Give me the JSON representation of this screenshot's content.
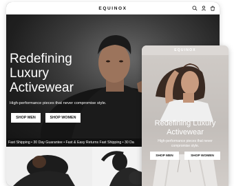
{
  "desktop": {
    "brand": "EQUINOX",
    "nav_icons": [
      "search-icon",
      "user-icon",
      "cart-icon"
    ],
    "hero": {
      "title_line1": "Redefining",
      "title_line2": "Luxury",
      "title_line3": "Activewear",
      "subtitle": "High-performance pieces that never compromise style.",
      "btn_men": "SHOP MEN",
      "btn_women": "SHOP WOMEN"
    },
    "shipping_bar": "Fast Shipping • 30 Day Guarantee • Fast & Easy Returns      Fast Shipping • 30 Da"
  },
  "mobile": {
    "brand": "EQUINOX",
    "hero": {
      "title_line1": "Redefining Luxury",
      "title_line2": "Activewear",
      "subtitle": "High-performance pieces that never compromise style.",
      "btn_men": "SHOP MEN",
      "btn_women": "SHOP WOMEN"
    }
  },
  "colors": {
    "dark_bg": "#1f1f1f",
    "shipping_bg": "#111111",
    "button_bg": "#ffffff",
    "mobile_bg": "#d6d2cf"
  }
}
